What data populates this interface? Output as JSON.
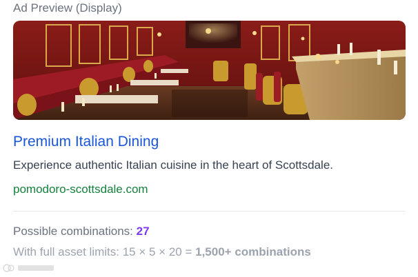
{
  "ad_preview": {
    "section_label": "Ad Preview (Display)",
    "image": {
      "description_icon": "restaurant-interior-image"
    },
    "headline": "Premium Italian Dining",
    "description": "Experience authentic Italian cuisine in the heart of Scottsdale.",
    "display_url": "pomodoro-scottsdale.com"
  },
  "stats": {
    "combinations_label": "Possible combinations:",
    "combinations_value": "27",
    "limits_label": "With full asset limits:",
    "limits_formula": "15 × 5 × 20 =",
    "limits_result": "1,500+ combinations"
  },
  "colors": {
    "headline": "#1a56db",
    "url": "#15803d",
    "accent_number": "#7c3aed"
  }
}
